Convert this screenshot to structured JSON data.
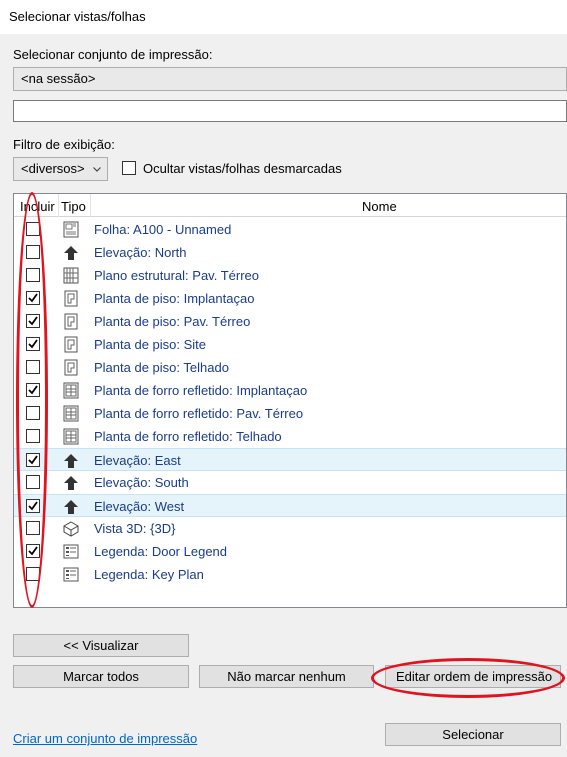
{
  "window": {
    "title": "Selecionar vistas/folhas"
  },
  "print_set": {
    "label": "Selecionar conjunto de impressão:",
    "value": "<na sessão>",
    "name_value": ""
  },
  "filter": {
    "label": "Filtro de exibição:",
    "value": "<diversos>",
    "hide_unchecked_label": "Ocultar vistas/folhas desmarcadas",
    "hide_unchecked_checked": false
  },
  "list": {
    "columns": {
      "include": "Incluir",
      "type": "Tipo",
      "name": "Nome"
    },
    "rows": [
      {
        "name": "Folha: A100 - Unnamed",
        "icon": "sheet-icon",
        "checked": false
      },
      {
        "name": "Elevação: North",
        "icon": "elevation-icon",
        "checked": false
      },
      {
        "name": "Plano estrutural: Pav. Térreo",
        "icon": "structural-plan-icon",
        "checked": false
      },
      {
        "name": "Planta de piso: Implantaçao",
        "icon": "floor-plan-icon",
        "checked": true
      },
      {
        "name": "Planta de piso: Pav. Térreo",
        "icon": "floor-plan-icon",
        "checked": true
      },
      {
        "name": "Planta de piso: Site",
        "icon": "floor-plan-icon",
        "checked": true
      },
      {
        "name": "Planta de piso: Telhado",
        "icon": "floor-plan-icon",
        "checked": false
      },
      {
        "name": "Planta de forro refletido: Implantaçao",
        "icon": "ceiling-plan-icon",
        "checked": true
      },
      {
        "name": "Planta de forro refletido: Pav. Térreo",
        "icon": "ceiling-plan-icon",
        "checked": false
      },
      {
        "name": "Planta de forro refletido: Telhado",
        "icon": "ceiling-plan-icon",
        "checked": false
      },
      {
        "name": "Elevação: East",
        "icon": "elevation-icon",
        "checked": true,
        "selected": true
      },
      {
        "name": "Elevação: South",
        "icon": "elevation-icon",
        "checked": false
      },
      {
        "name": "Elevação: West",
        "icon": "elevation-icon",
        "checked": true,
        "selected": true
      },
      {
        "name": "Vista 3D: {3D}",
        "icon": "3d-view-icon",
        "checked": false
      },
      {
        "name": "Legenda: Door Legend",
        "icon": "legend-icon",
        "checked": true
      },
      {
        "name": "Legenda: Key Plan",
        "icon": "legend-icon",
        "checked": false
      }
    ]
  },
  "buttons": {
    "preview": "<< Visualizar",
    "check_all": "Marcar todos",
    "check_none": "Não marcar nenhum",
    "edit_order": "Editar ordem de impressão",
    "select": "Selecionar"
  },
  "create_set_link": "Criar um conjunto de impressão",
  "colors": {
    "annotation": "#e0141e",
    "link": "#0066cc",
    "row_text": "#1a3c8c",
    "selected_row": "#e5f3fb"
  }
}
